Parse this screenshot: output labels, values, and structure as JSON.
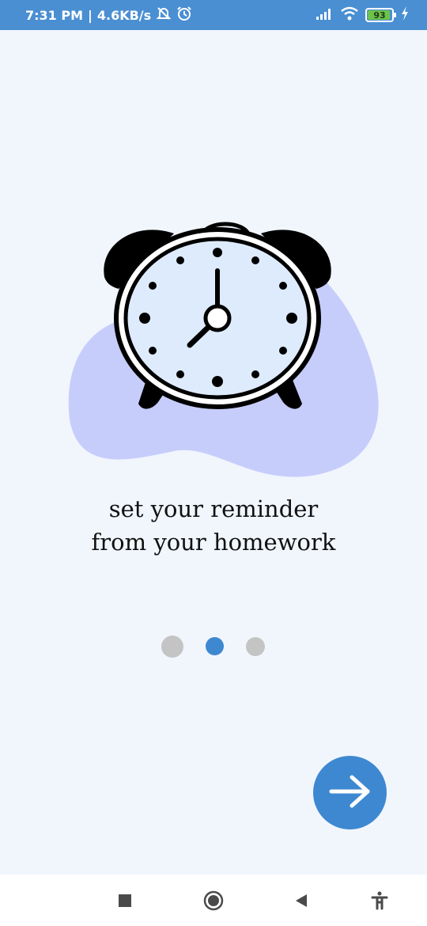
{
  "status_bar": {
    "time": "7:31 PM",
    "separator": "|",
    "network_speed": "4.6KB/s",
    "battery_level": "93",
    "icons": [
      "muted-alarm-icon",
      "alarm-icon",
      "signal-icon",
      "wifi-icon",
      "battery-icon",
      "charging-icon"
    ]
  },
  "onboarding": {
    "illustration": "alarm-clock-illustration",
    "caption_line1": "set your reminder",
    "caption_line2": "from your homework",
    "pages": 3,
    "current_page": 2
  },
  "next_button": {
    "icon": "arrow-right-icon"
  },
  "nav_bar": {
    "icons": [
      "recents-square-icon",
      "home-circle-icon",
      "back-triangle-icon",
      "accessibility-icon"
    ]
  },
  "colors": {
    "status_bar": "#4a8fd2",
    "background": "#f1f6fd",
    "blob": "#c7cdfb",
    "clock_face": "#deebfd",
    "dot_active": "#3e88d1",
    "dot_inactive": "#c4c4c4",
    "button": "#3e88d1"
  }
}
